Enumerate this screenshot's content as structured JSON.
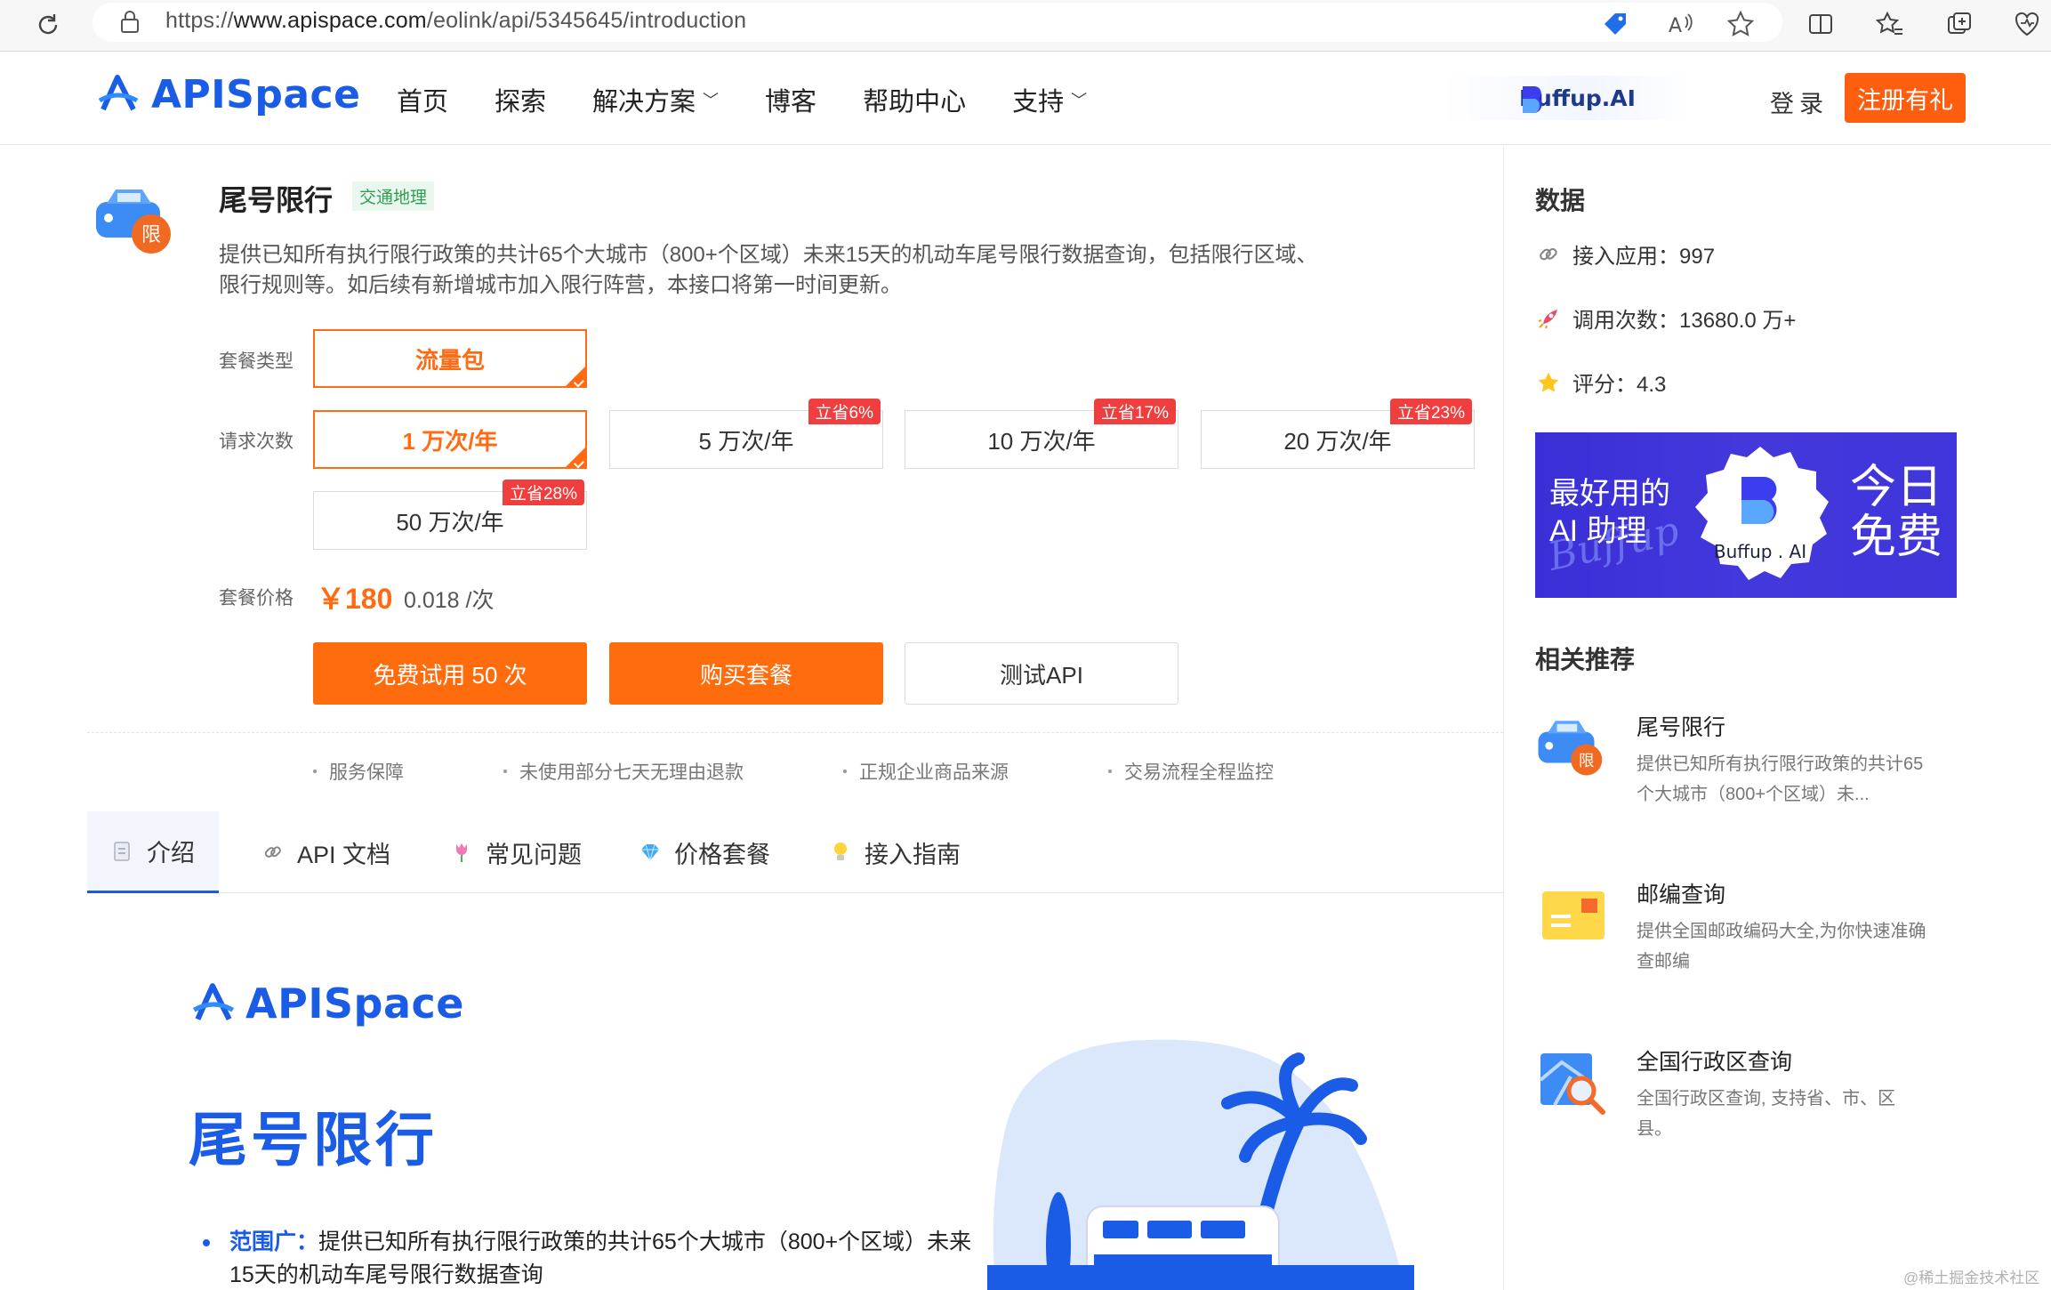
{
  "browser": {
    "url_prefix": "https://",
    "url_host": "www.apispace.com",
    "url_path": "/eolink/api/5345645/introduction"
  },
  "header": {
    "logo_text": "APISpace",
    "nav": [
      {
        "label": "首页",
        "dropdown": false
      },
      {
        "label": "探索",
        "dropdown": false
      },
      {
        "label": "解决方案",
        "dropdown": true
      },
      {
        "label": "博客",
        "dropdown": false
      },
      {
        "label": "帮助中心",
        "dropdown": false
      },
      {
        "label": "支持",
        "dropdown": true
      }
    ],
    "buffup_label": "Buffup.AI",
    "login_label": "登录",
    "register_label": "注册有礼"
  },
  "product": {
    "title": "尾号限行",
    "category_tag": "交通地理",
    "description": "提供已知所有执行限行政策的共计65个大城市（800+个区域）未来15天的机动车尾号限行数据查询，包括限行区域、限行规则等。如后续有新增城市加入限行阵营，本接口将第一时间更新。",
    "package_type_label": "套餐类型",
    "package_types": [
      "流量包"
    ],
    "request_count_label": "请求次数",
    "request_options": [
      {
        "label": "1 万次/年",
        "badge": "",
        "selected": true
      },
      {
        "label": "5 万次/年",
        "badge": "立省6%",
        "selected": false
      },
      {
        "label": "10 万次/年",
        "badge": "立省17%",
        "selected": false
      },
      {
        "label": "20 万次/年",
        "badge": "立省23%",
        "selected": false
      },
      {
        "label": "50 万次/年",
        "badge": "立省28%",
        "selected": false
      }
    ],
    "price_label": "套餐价格",
    "price": "￥180",
    "unit_price": "0.018 /次",
    "buttons": {
      "free_trial": "免费试用 50 次",
      "buy": "购买套餐",
      "test_api": "测试API"
    },
    "guarantees": [
      "服务保障",
      "未使用部分七天无理由退款",
      "正规企业商品来源",
      "交易流程全程监控"
    ]
  },
  "tabs": [
    {
      "label": "介绍",
      "icon": "document-icon",
      "active": true
    },
    {
      "label": "API 文档",
      "icon": "link-icon",
      "active": false
    },
    {
      "label": "常见问题",
      "icon": "tulip-icon",
      "active": false
    },
    {
      "label": "价格套餐",
      "icon": "diamond-icon",
      "active": false
    },
    {
      "label": "接入指南",
      "icon": "lightbulb-icon",
      "active": false
    }
  ],
  "intro": {
    "logo_text": "APISpace",
    "title": "尾号限行",
    "bullet_lead": "范围广：",
    "bullet_text": "提供已知所有执行限行政策的共计65个大城市（800+个区域）未来15天的机动车尾号限行数据查询"
  },
  "sidebar": {
    "data_heading": "数据",
    "stats": [
      {
        "label": "接入应用：",
        "value": "997",
        "icon": "link-icon"
      },
      {
        "label": "调用次数：",
        "value": "13680.0 万+",
        "icon": "rocket-icon"
      },
      {
        "label": "评分：",
        "value": "4.3",
        "icon": "star-icon"
      }
    ],
    "ad": {
      "left_line1": "最好用的",
      "left_line2": "AI 助理",
      "script_text": "Buffup",
      "badge_text": "Buffup . AI",
      "right_line1": "今日",
      "right_line2": "免费"
    },
    "related_heading": "相关推荐",
    "related": [
      {
        "title": "尾号限行",
        "desc": "提供已知所有执行限行政策的共计65个大城市（800+个区域）未...",
        "icon": "car-icon"
      },
      {
        "title": "邮编查询",
        "desc": "提供全国邮政编码大全,为你快速准确查邮编",
        "icon": "envelope-icon"
      },
      {
        "title": "全国行政区查询",
        "desc": "全国行政区查询, 支持省、市、区县。",
        "icon": "map-search-icon"
      }
    ]
  },
  "watermark": "@稀土掘金技术社区",
  "colors": {
    "brand_blue": "#1a5ce6",
    "accent_orange": "#ff6c0d",
    "badge_red": "#f03d3d",
    "ad_purple": "#3f35da"
  }
}
